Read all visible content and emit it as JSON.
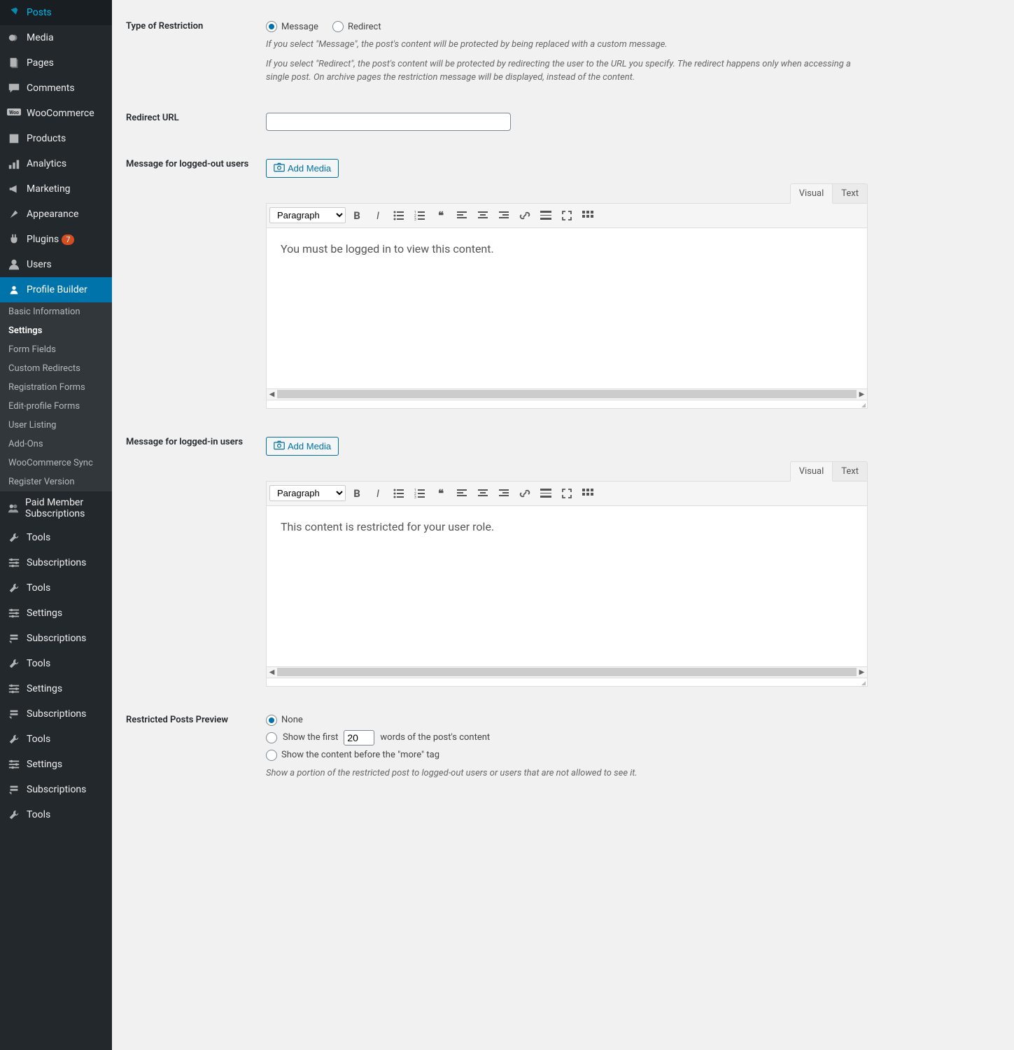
{
  "sidebar": {
    "items": [
      {
        "icon": "pin",
        "label": "Posts"
      },
      {
        "icon": "media",
        "label": "Media"
      },
      {
        "icon": "page",
        "label": "Pages"
      },
      {
        "icon": "comment",
        "label": "Comments"
      },
      {
        "icon": "woo",
        "label": "WooCommerce"
      },
      {
        "icon": "products",
        "label": "Products"
      },
      {
        "icon": "analytics",
        "label": "Analytics"
      },
      {
        "icon": "marketing",
        "label": "Marketing"
      },
      {
        "icon": "appearance",
        "label": "Appearance"
      },
      {
        "icon": "plugins",
        "label": "Plugins",
        "badge": "7"
      },
      {
        "icon": "users",
        "label": "Users"
      },
      {
        "icon": "profile",
        "label": "Profile Builder",
        "active": true
      },
      {
        "icon": "pms",
        "label": "Paid Member Subscriptions"
      },
      {
        "icon": "tools",
        "label": "Tools"
      },
      {
        "icon": "settings",
        "label": "Subscriptions"
      },
      {
        "icon": "tools",
        "label": "Tools"
      },
      {
        "icon": "settings",
        "label": "Settings"
      },
      {
        "icon": "sub",
        "label": "Subscriptions"
      },
      {
        "icon": "tools",
        "label": "Tools"
      },
      {
        "icon": "settings",
        "label": "Settings"
      },
      {
        "icon": "sub",
        "label": "Subscriptions"
      },
      {
        "icon": "tools",
        "label": "Tools"
      },
      {
        "icon": "settings",
        "label": "Settings"
      },
      {
        "icon": "sub",
        "label": "Subscriptions"
      },
      {
        "icon": "tools",
        "label": "Tools"
      }
    ],
    "submenu": [
      "Basic Information",
      "Settings",
      "Form Fields",
      "Custom Redirects",
      "Registration Forms",
      "Edit-profile Forms",
      "User Listing",
      "Add-Ons",
      "WooCommerce Sync",
      "Register Version"
    ],
    "submenu_active": 1
  },
  "form": {
    "type_label": "Type of Restriction",
    "type_opt1": "Message",
    "type_opt2": "Redirect",
    "type_help1": "If you select \"Message\", the post's content will be protected by being replaced with a custom message.",
    "type_help2": "If you select \"Redirect\", the post's content will be protected by redirecting the user to the URL you specify. The redirect happens only when accessing a single post. On archive pages the restriction message will be displayed, instead of the content.",
    "redirect_label": "Redirect URL",
    "redirect_value": "",
    "msg_out_label": "Message for logged-out users",
    "msg_in_label": "Message for logged-in users",
    "add_media": "Add Media",
    "tab_visual": "Visual",
    "tab_text": "Text",
    "format_option": "Paragraph",
    "msg_out_body": "You must be logged in to view this content.",
    "msg_in_body": "This content is restricted for your user role.",
    "preview_label": "Restricted Posts Preview",
    "preview_none": "None",
    "preview_first_a": "Show the first",
    "preview_first_val": "20",
    "preview_first_b": "words of the post's content",
    "preview_more": "Show the content before the \"more\" tag",
    "preview_help": "Show a portion of the restricted post to logged-out users or users that are not allowed to see it."
  }
}
